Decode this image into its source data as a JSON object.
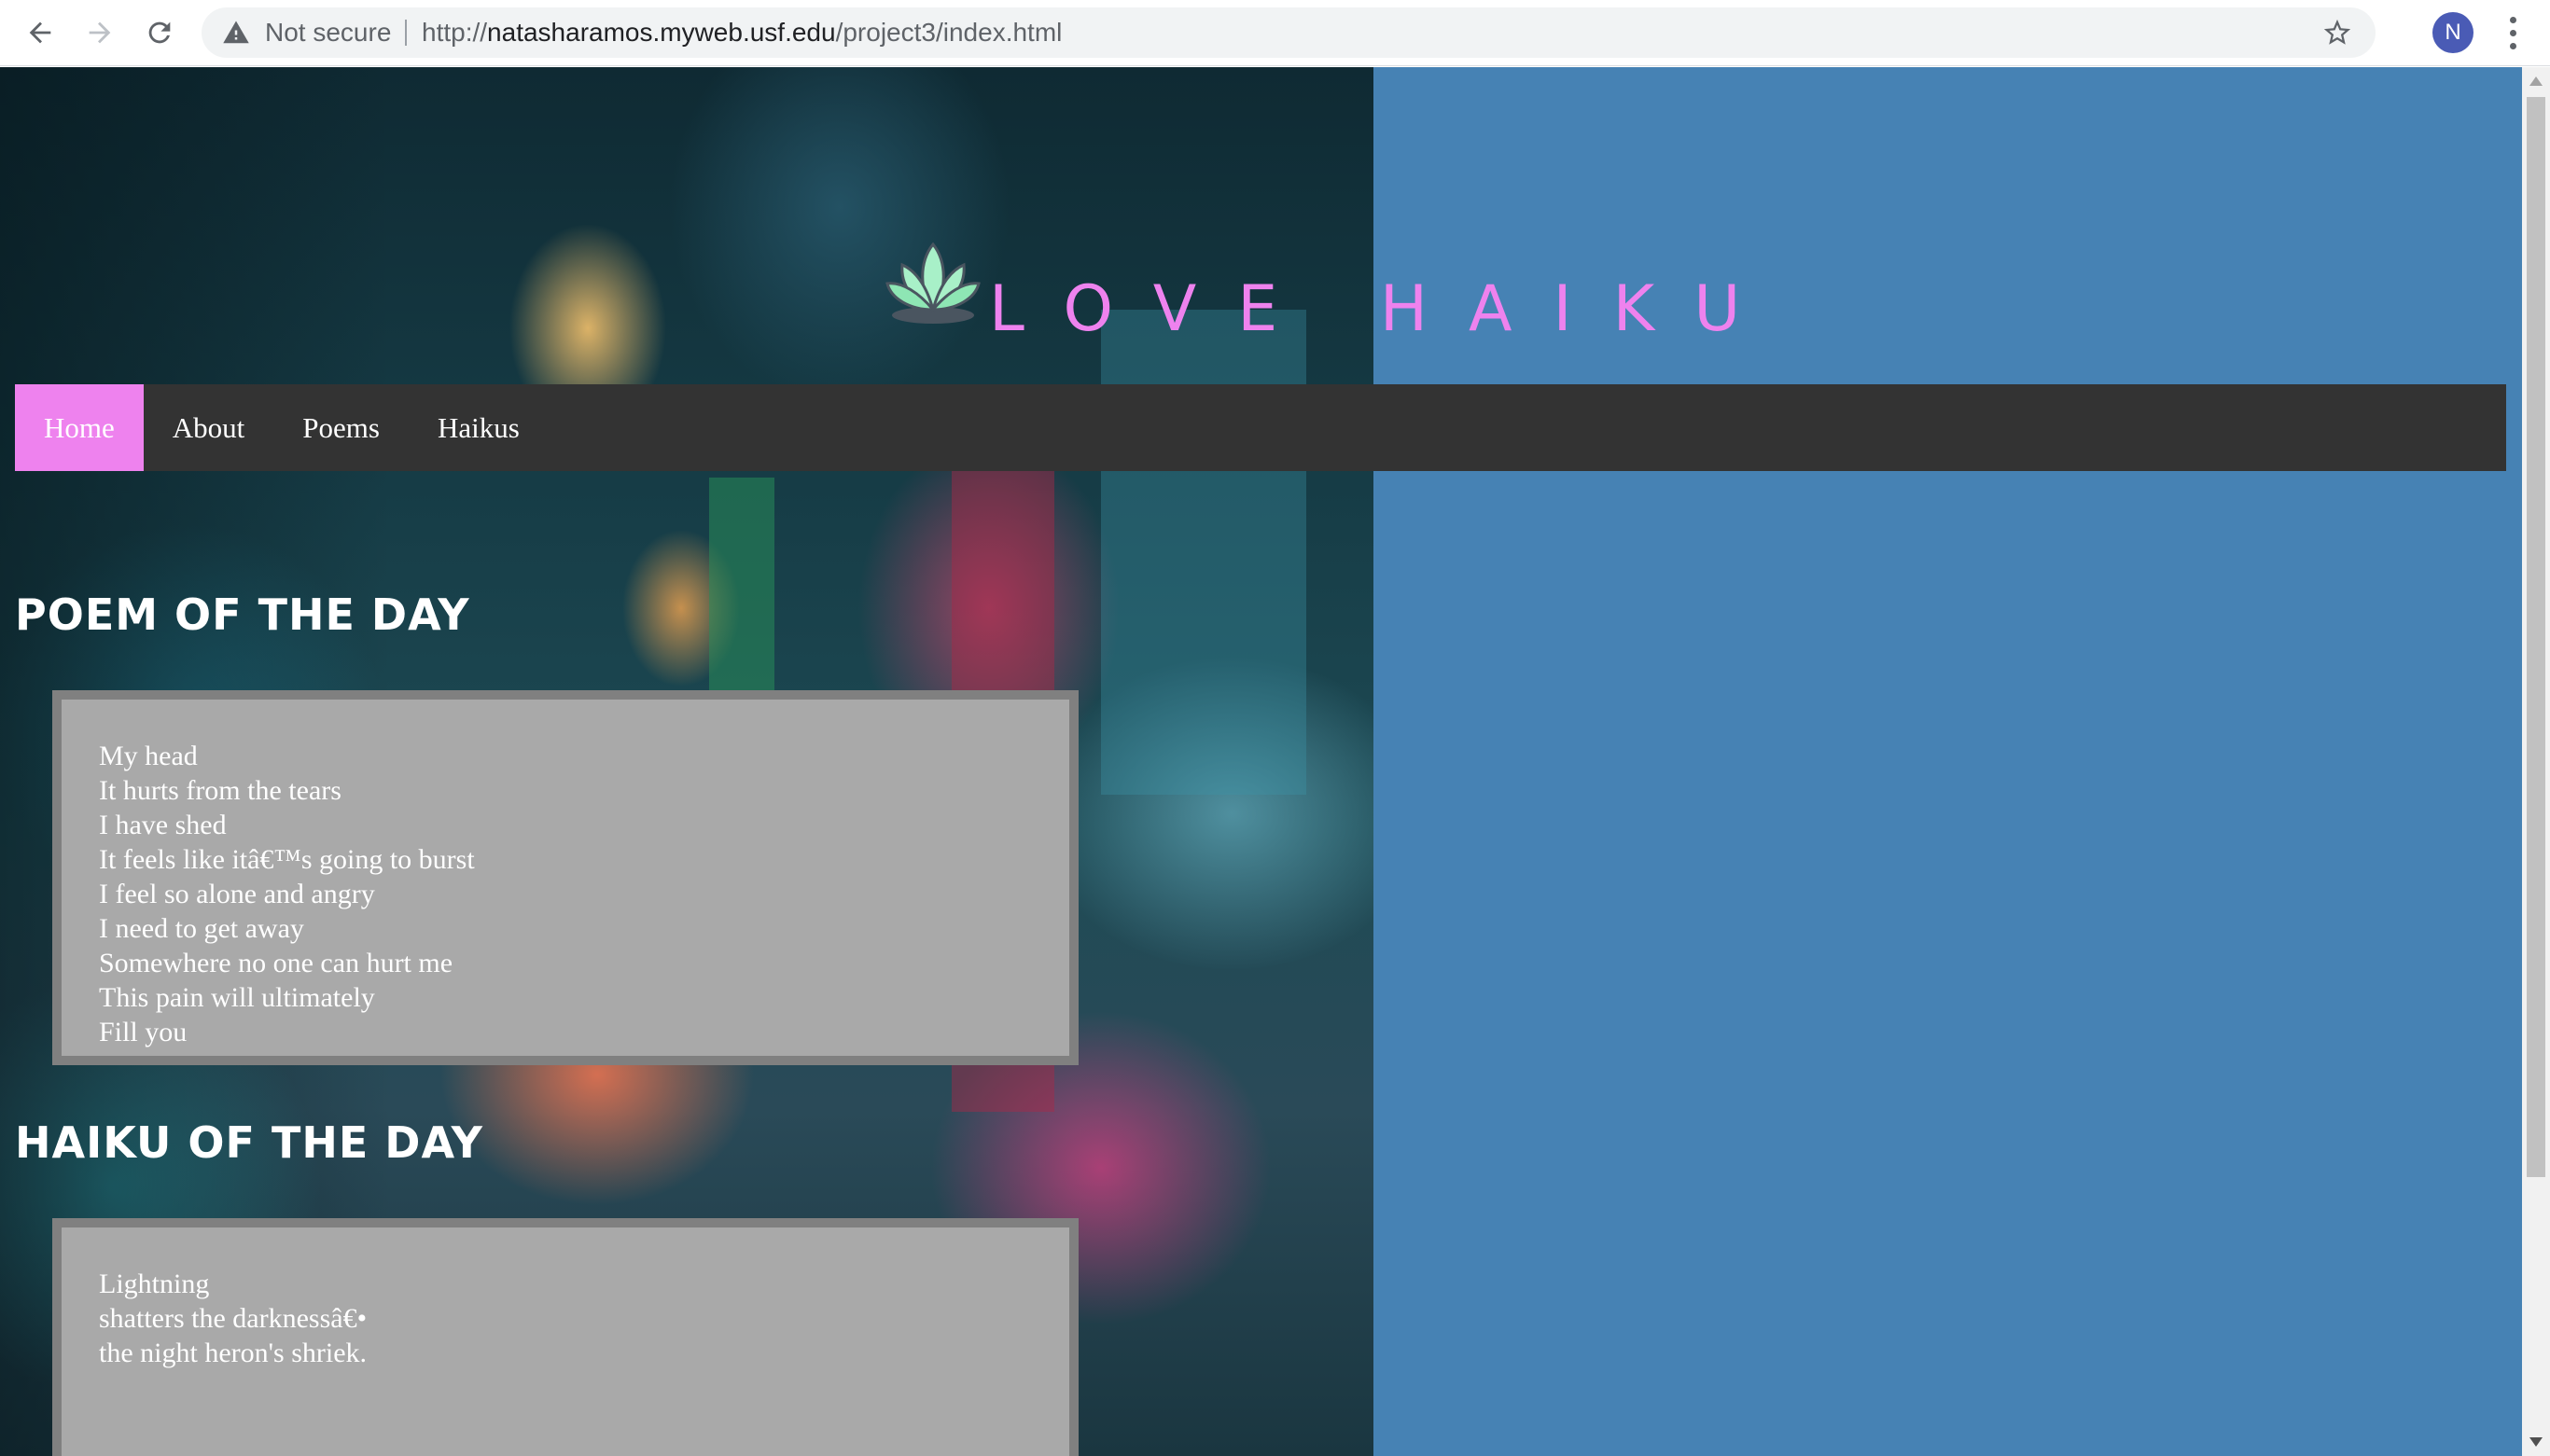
{
  "browser": {
    "security_label": "Not secure",
    "url_prefix": "http://",
    "url_host": "natasharamos.myweb.usf.edu",
    "url_path": "/project3/index.html",
    "profile_initial": "N"
  },
  "site": {
    "title": "LOVE HAIKU",
    "title_color": "#ee82ee",
    "page_background": "#4682b4",
    "nav_background": "#333333",
    "active_nav_color": "#ee82ee",
    "box_background": "#a9a9a9",
    "box_border": "#808080"
  },
  "nav": {
    "items": [
      {
        "label": "Home",
        "active": true
      },
      {
        "label": "About",
        "active": false
      },
      {
        "label": "Poems",
        "active": false
      },
      {
        "label": "Haikus",
        "active": false
      }
    ]
  },
  "poem": {
    "heading": "POEM OF THE DAY",
    "lines": [
      "My head",
      "It hurts from the tears",
      "I have shed",
      "It feels like itâ€™s going to burst",
      "I feel so alone and angry",
      "I need to get away",
      "Somewhere no one can hurt me",
      "This pain will ultimately",
      "Fill you"
    ]
  },
  "haiku": {
    "heading": "HAIKU OF THE DAY",
    "lines": [
      "Lightning",
      "shatters the darknessâ€•",
      "the night heron's shriek."
    ]
  }
}
